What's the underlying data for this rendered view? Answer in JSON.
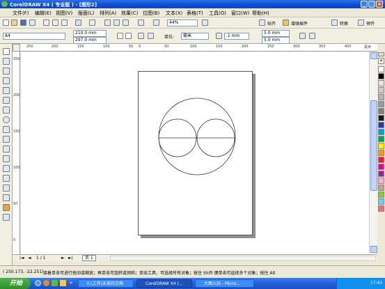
{
  "window": {
    "title": "CorelDRAW X4 ( 专业版 ) - [图形2]"
  },
  "menu": [
    "文件(F)",
    "编辑(E)",
    "视图(V)",
    "版面(L)",
    "排列(A)",
    "效果(C)",
    "位图(B)",
    "文本(X)",
    "表格(T)",
    "工具(O)",
    "窗口(W)",
    "帮助(H)"
  ],
  "toolbar": {
    "zoom": "44%",
    "snap_label": "贴齐",
    "enhanced_plugin_label": "增强插件",
    "convert_label": "转换",
    "align_label": "预齐"
  },
  "property_bar": {
    "paper": "A4",
    "width": "210.0 mm",
    "height": "297.0 mm",
    "unit_label": "单位:",
    "unit": "毫米",
    "nudge": ".1 mm",
    "dup_x": "5.0 mm",
    "dup_y": "5.0 mm"
  },
  "ruler": {
    "top": [
      "250",
      "200",
      "150",
      "100",
      "50",
      "0",
      "50",
      "100",
      "150",
      "200",
      "250",
      "300",
      "350",
      "400"
    ],
    "left": [
      "250",
      "200",
      "150",
      "100",
      "50",
      "0"
    ],
    "unit": "毫米"
  },
  "page_nav": {
    "current": "1 / 1",
    "tab": "页 1"
  },
  "status": {
    "coords": "( 250.173, -22.251)",
    "hint": "接着单击可进行拖动或缩放；再单击可旋转或倾斜；双击工具，可选择所有对象；按住 Shift 键单击可选择多个对象；按住 Alt"
  },
  "taskbar": {
    "start": "开始",
    "tasks": [
      "E:\\工作\\未发的文档",
      "CorelDRAW X4 (...",
      "大图入封 - Micro..."
    ],
    "time": "17:43"
  },
  "palette_colors": [
    "#ffffff",
    "#000000",
    "#e6e6e6",
    "#cccccc",
    "#b3b3b3",
    "#999999",
    "#808080",
    "#1a1a1a",
    "#1f3ea8",
    "#00a0e0",
    "#00a651",
    "#fff200",
    "#f7941d",
    "#ed1c24",
    "#ec008c",
    "#92278f",
    "#f9b2d4",
    "#c4a484",
    "#8dc63f",
    "#6dcff6",
    "#f26d7d"
  ]
}
